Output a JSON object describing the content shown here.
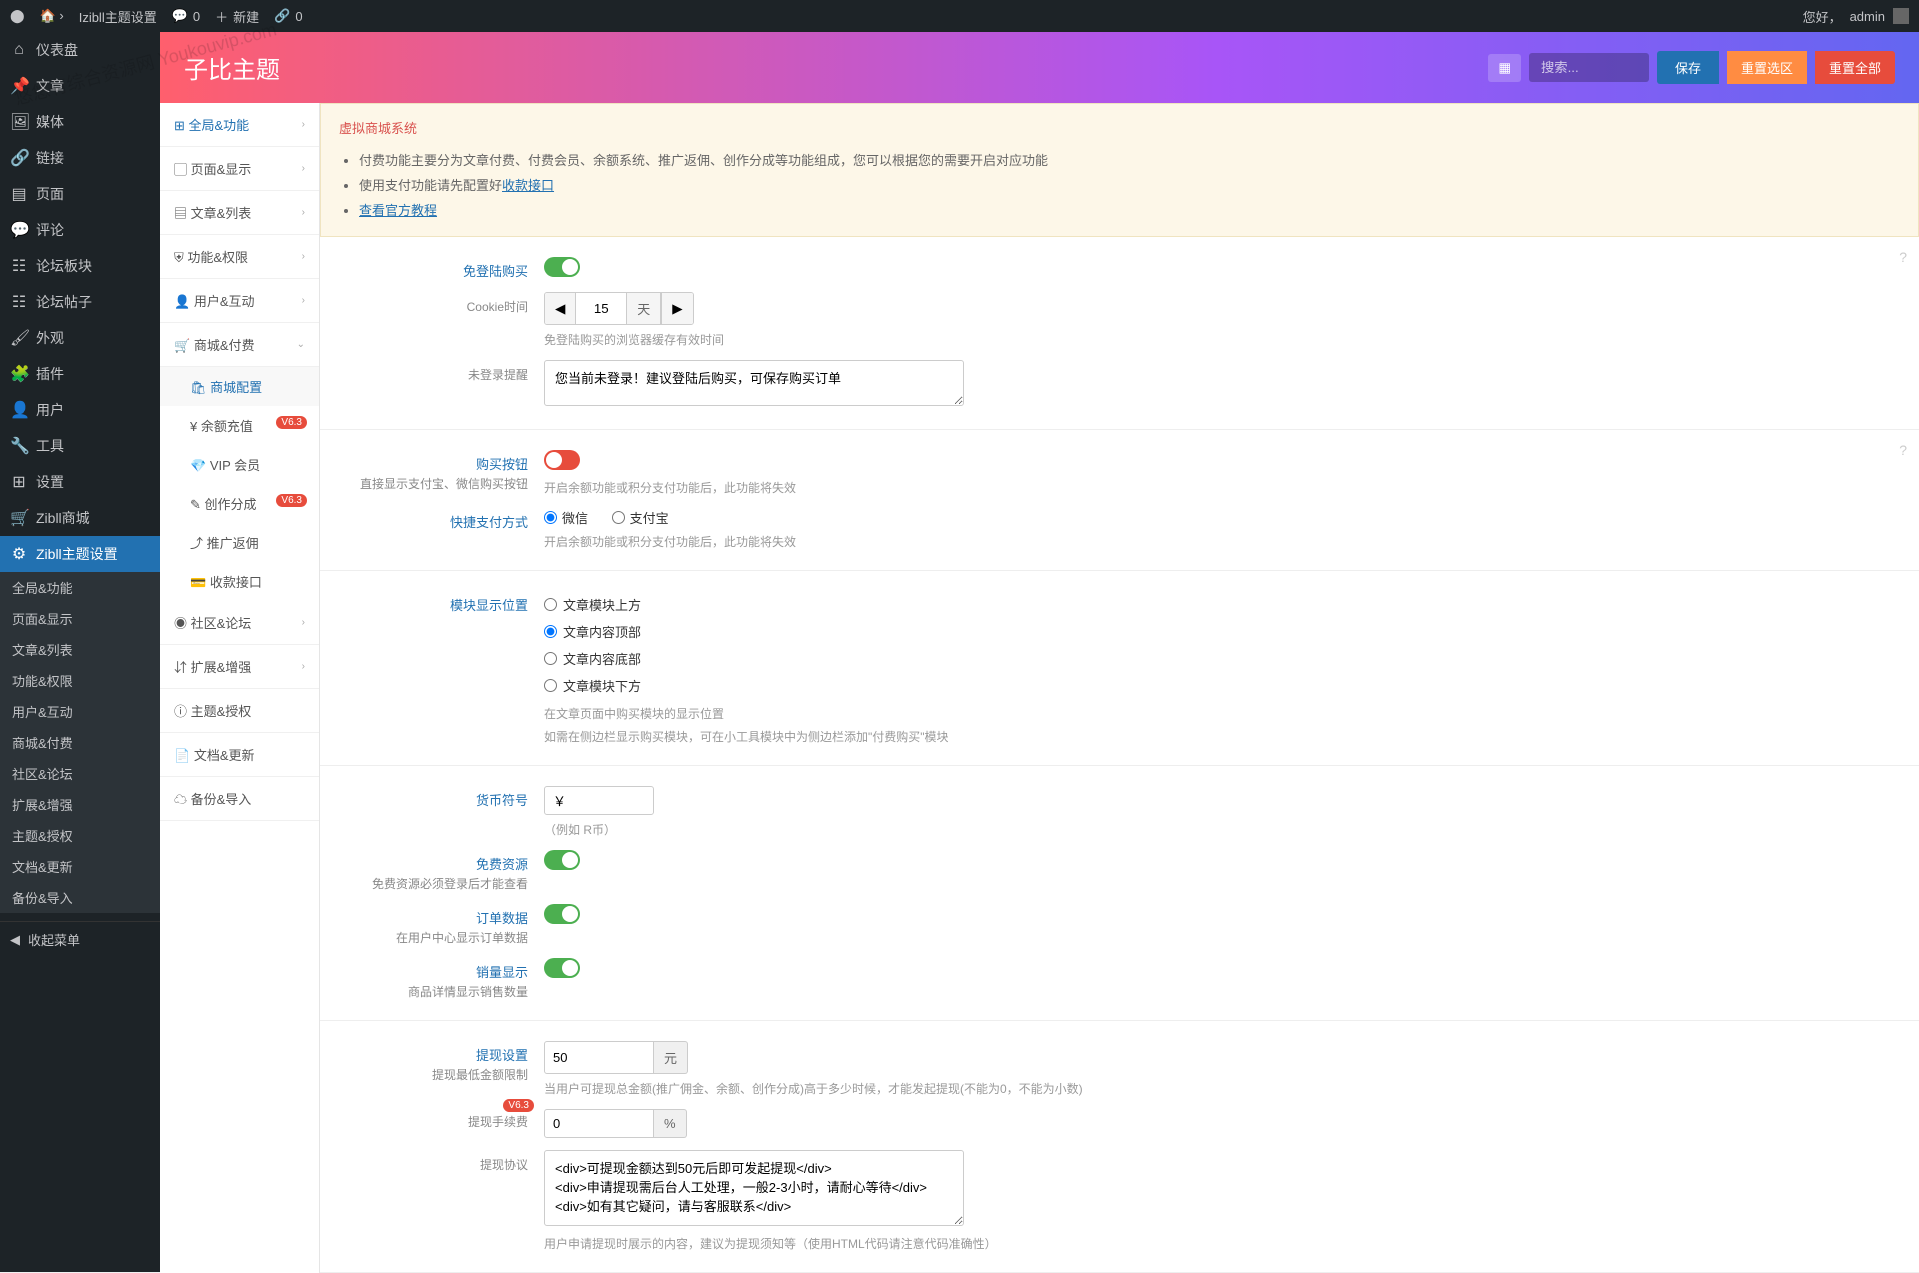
{
  "admin_bar": {
    "site": "Izibll主题设置",
    "comments": "0",
    "new": "新建",
    "links": "0",
    "greeting": "您好，",
    "user": "admin"
  },
  "wp_menu": {
    "dashboard": "仪表盘",
    "posts": "文章",
    "media": "媒体",
    "links": "链接",
    "pages": "页面",
    "comments": "评论",
    "forum_board": "论坛板块",
    "forum_post": "论坛帖子",
    "appearance": "外观",
    "plugins": "插件",
    "users": "用户",
    "tools": "工具",
    "settings": "设置",
    "zibll_mall": "Zibll商城",
    "zibll_theme": "Zibll主题设置",
    "collapse": "收起菜单"
  },
  "wp_submenu": {
    "global": "全局&功能",
    "page_display": "页面&显示",
    "article_list": "文章&列表",
    "function_perm": "功能&权限",
    "user_interact": "用户&互动",
    "mall_pay": "商城&付费",
    "community_forum": "社区&论坛",
    "extend_enhance": "扩展&增强",
    "theme_auth": "主题&授权",
    "doc_update": "文档&更新",
    "backup_import": "备份&导入"
  },
  "theme_header": {
    "title": "子比主题",
    "search_placeholder": "搜索...",
    "save": "保存",
    "reset_section": "重置选区",
    "reset_all": "重置全部"
  },
  "settings_nav": {
    "global": "全局&功能",
    "page_display": "页面&显示",
    "article_list": "文章&列表",
    "function_perm": "功能&权限",
    "user_interact": "用户&互动",
    "mall_pay": "商城&付费",
    "mall_config": "商城配置",
    "balance_recharge": "余额充值",
    "vip_member": "VIP 会员",
    "creation_share": "创作分成",
    "promo_rebate": "推广返佣",
    "payment_api": "收款接口",
    "community_forum": "社区&论坛",
    "extend_enhance": "扩展&增强",
    "theme_auth": "主题&授权",
    "doc_update": "文档&更新",
    "backup_import": "备份&导入",
    "badge": "V6.3"
  },
  "notice": {
    "title": "虚拟商城系统",
    "item1": "付费功能主要分为文章付费、付费会员、余额系统、推广返佣、创作分成等功能组成，您可以根据您的需要开启对应功能",
    "item2": "使用支付功能请先配置好",
    "item2_link": "收款接口",
    "item3_link": "查看官方教程"
  },
  "form": {
    "guest_buy": {
      "label": "免登陆购买"
    },
    "cookie_time": {
      "label": "Cookie时间",
      "value": "15",
      "unit": "天",
      "help": "免登陆购买的浏览器缓存有效时间"
    },
    "not_login_tip": {
      "label": "未登录提醒",
      "value": "您当前未登录！建议登陆后购买，可保存购买订单"
    },
    "buy_button": {
      "label": "购买按钮",
      "sub": "直接显示支付宝、微信购买按钮",
      "help": "开启余额功能或积分支付功能后，此功能将失效"
    },
    "quickpay": {
      "label": "快捷支付方式",
      "opt1": "微信",
      "opt2": "支付宝",
      "help": "开启余额功能或积分支付功能后，此功能将失效"
    },
    "module_pos": {
      "label": "模块显示位置",
      "opt1": "文章模块上方",
      "opt2": "文章内容顶部",
      "opt3": "文章内容底部",
      "opt4": "文章模块下方",
      "help1": "在文章页面中购买模块的显示位置",
      "help2": "如需在侧边栏显示购买模块，可在小工具模块中为侧边栏添加\"付费购买\"模块"
    },
    "currency": {
      "label": "货币符号",
      "value": "￥",
      "help": "（例如 R币）"
    },
    "free_resource": {
      "label": "免费资源",
      "sub": "免费资源必须登录后才能查看"
    },
    "order_data": {
      "label": "订单数据",
      "sub": "在用户中心显示订单数据"
    },
    "sales_display": {
      "label": "销量显示",
      "sub": "商品详情显示销售数量"
    },
    "withdraw": {
      "label": "提现设置",
      "sub": "提现最低金额限制",
      "value": "50",
      "unit": "元",
      "help": "当用户可提现总金额(推广佣金、余额、创作分成)高于多少时候，才能发起提现(不能为0，不能为小数)"
    },
    "withdraw_fee": {
      "label": "提现手续费",
      "badge": "V6.3",
      "value": "0",
      "unit": "%"
    },
    "withdraw_agreement": {
      "label": "提现协议",
      "value": "<div>可提现金额达到50元后即可发起提现</div>\n<div>申请提现需后台人工处理，一般2-3小时，请耐心等待</div>\n<div>如有其它疑问，请与客服联系</div>",
      "help": "用户申请提现时展示的内容，建议为提现须知等（使用HTML代码请注意代码准确性）"
    }
  },
  "watermark": "悠悠有综合资源网\nYoukouvip.com"
}
